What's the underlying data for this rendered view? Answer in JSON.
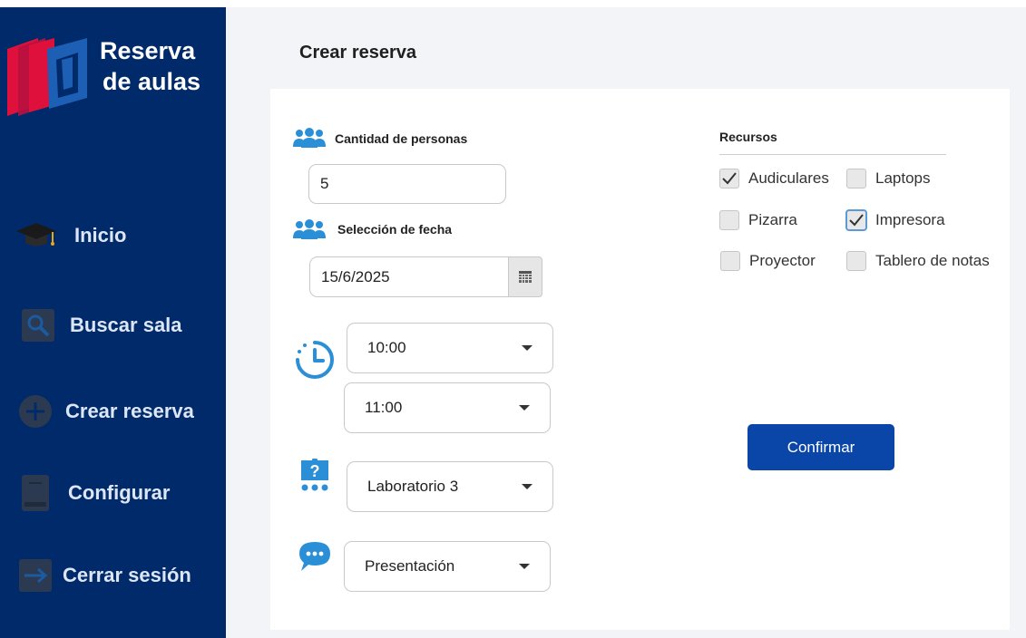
{
  "brand": {
    "line1": "Reserva",
    "line2": "de aulas"
  },
  "sidebar": {
    "items": [
      {
        "label": "Inicio",
        "icon": "graduation-cap-icon"
      },
      {
        "label": "Buscar sala",
        "icon": "search-icon"
      },
      {
        "label": "Crear reserva",
        "icon": "plus-circle-icon"
      },
      {
        "label": "Configurar",
        "icon": "book-icon"
      },
      {
        "label": "Cerrar sesión",
        "icon": "logout-arrow-icon"
      }
    ]
  },
  "page": {
    "title": "Crear reserva"
  },
  "form": {
    "people_label": "Cantidad de personas",
    "people_value": "5",
    "date_label": "Selección de fecha",
    "date_value": "15/6/2025",
    "start_time": "10:00",
    "end_time": "11:00",
    "room": "Laboratorio 3",
    "purpose": "Presentación"
  },
  "resources": {
    "title": "Recursos",
    "items": [
      {
        "label": "Audiculares",
        "checked": true
      },
      {
        "label": "Laptops",
        "checked": false
      },
      {
        "label": "Pizarra",
        "checked": false
      },
      {
        "label": "Impresora",
        "checked": true
      },
      {
        "label": "Proyector",
        "checked": false
      },
      {
        "label": "Tablero de notas",
        "checked": false
      }
    ]
  },
  "actions": {
    "confirm_label": "Confirmar"
  },
  "colors": {
    "sidebar": "#002a6a",
    "accent": "#0a45a8",
    "icon_blue": "#2a8fd6",
    "logo_red": "#e0103c"
  }
}
